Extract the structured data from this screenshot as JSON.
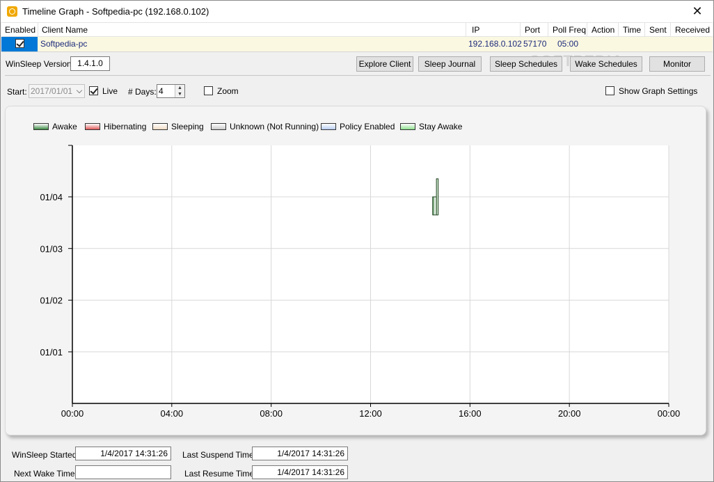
{
  "window": {
    "title": "Timeline Graph - Softpedia-pc (192.168.0.102)"
  },
  "table": {
    "columns": [
      "Enabled",
      "Client Name",
      "IP",
      "Port",
      "Poll Freq",
      "Action",
      "Time",
      "Sent",
      "Received"
    ],
    "row": {
      "enabled": true,
      "client_name": "Softpedia-pc",
      "ip": "192.168.0.102",
      "port": "57170",
      "poll_freq": "05:00",
      "action": "",
      "time": "",
      "sent": "",
      "received": ""
    }
  },
  "version": {
    "label": "WinSleep Version:",
    "value": "1.4.1.0"
  },
  "buttons": {
    "explore_client": "Explore Client",
    "sleep_journal": "Sleep Journal",
    "sleep_schedules": "Sleep Schedules",
    "wake_schedules": "Wake Schedules",
    "monitor": "Monitor"
  },
  "options": {
    "start_label": "Start:",
    "start_value": "2017/01/01",
    "live_label": "Live",
    "live_checked": true,
    "days_label": "# Days:",
    "days_value": "4",
    "zoom_label": "Zoom",
    "zoom_checked": false,
    "show_graph_settings_label": "Show Graph Settings",
    "show_graph_settings_checked": false
  },
  "legend": [
    {
      "label": "Awake",
      "color": "#3e8a45"
    },
    {
      "label": "Hibernating",
      "color": "#e05a5a"
    },
    {
      "label": "Sleeping",
      "color": "#f1dcc4"
    },
    {
      "label": "Unknown (Not Running)",
      "color": "#c9c9c9"
    },
    {
      "label": "Policy Enabled",
      "color": "#b8cdf2"
    },
    {
      "label": "Stay Awake",
      "color": "#8fe08f"
    }
  ],
  "chart_data": {
    "type": "bar",
    "x_ticks": [
      "00:00",
      "04:00",
      "08:00",
      "12:00",
      "16:00",
      "20:00",
      "00:00"
    ],
    "x_range_hours": [
      0,
      24
    ],
    "y_ticks": [
      "01/04",
      "01/03",
      "01/02",
      "01/01"
    ],
    "grid": true,
    "bars": [
      {
        "state": "Awake",
        "day": "01/04",
        "start_hour": 14.5,
        "end_hour": 14.7
      },
      {
        "state": "Stay Awake",
        "day": "01/04",
        "start_hour": 14.65,
        "end_hour": 14.72
      }
    ]
  },
  "footer": {
    "winsleep_started_label": "WinSleep Started:",
    "winsleep_started_value": "1/4/2017  14:31:26",
    "last_suspend_label": "Last Suspend Time:",
    "last_suspend_value": "1/4/2017  14:31:26",
    "next_wake_label": "Next Wake Time:",
    "next_wake_value": "",
    "last_resume_label": "Last Resume Time:",
    "last_resume_value": "1/4/2017  14:31:26"
  },
  "watermark": "SOFTPEDIA"
}
